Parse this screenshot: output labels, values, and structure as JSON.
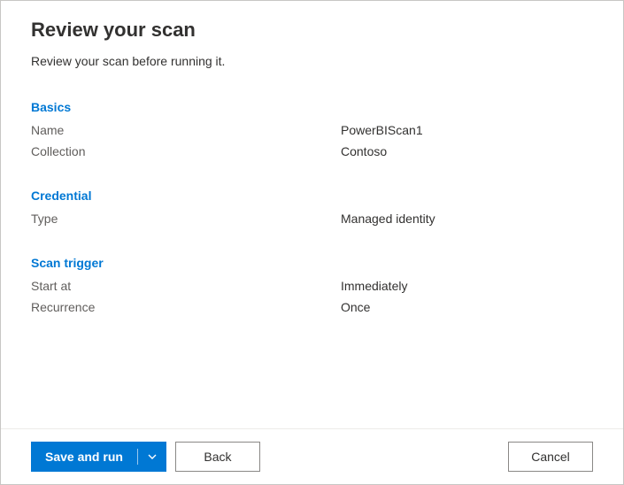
{
  "title": "Review your scan",
  "subtitle": "Review your scan before running it.",
  "sections": {
    "basics": {
      "header": "Basics",
      "name_label": "Name",
      "name_value": "PowerBIScan1",
      "collection_label": "Collection",
      "collection_value": "Contoso"
    },
    "credential": {
      "header": "Credential",
      "type_label": "Type",
      "type_value": "Managed identity"
    },
    "trigger": {
      "header": "Scan trigger",
      "start_label": "Start at",
      "start_value": "Immediately",
      "recurrence_label": "Recurrence",
      "recurrence_value": "Once"
    }
  },
  "footer": {
    "save_run_label": "Save and run",
    "back_label": "Back",
    "cancel_label": "Cancel"
  }
}
